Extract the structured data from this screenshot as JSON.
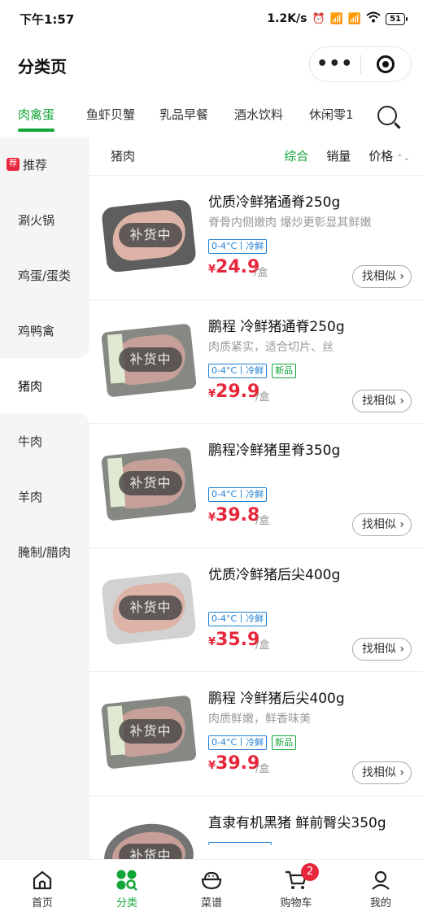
{
  "status_bar": {
    "time": "下午1:57",
    "net_speed": "1.2K/s",
    "battery": "51"
  },
  "title_bar": {
    "title": "分类页",
    "more_label": "•••"
  },
  "tabs": [
    {
      "label": "肉禽蛋",
      "active": true
    },
    {
      "label": "鱼虾贝蟹",
      "active": false
    },
    {
      "label": "乳品早餐",
      "active": false
    },
    {
      "label": "酒水饮料",
      "active": false
    },
    {
      "label": "休闲零1",
      "active": false
    }
  ],
  "sidebar": {
    "recommend_badge": "荐",
    "items": [
      {
        "label": "推荐"
      },
      {
        "label": "涮火锅"
      },
      {
        "label": "鸡蛋/蛋类"
      },
      {
        "label": "鸡鸭禽"
      },
      {
        "label": "猪肉",
        "active": true
      },
      {
        "label": "牛肉"
      },
      {
        "label": "羊肉"
      },
      {
        "label": "腌制/腊肉"
      }
    ]
  },
  "subheader": {
    "category": "猪肉",
    "sort_comprehensive": "综合",
    "sort_sales": "销量",
    "sort_price": "价格"
  },
  "products": [
    {
      "title": "优质冷鲜猪通脊250g",
      "desc": "脊骨内侧嫩肉 爆炒更彰显其鲜嫩",
      "tag_cold": "0-4°C丨冷鲜",
      "tag_new": "",
      "yen": "¥",
      "price": "24.9",
      "unit": "/盒",
      "stock": "补货中",
      "similar": "找相似 ›"
    },
    {
      "title": "鹏程 冷鲜猪通脊250g",
      "desc": "肉质紧实，适合切片、丝",
      "tag_cold": "0-4°C丨冷鲜",
      "tag_new": "新品",
      "yen": "¥",
      "price": "29.9",
      "unit": "/盒",
      "stock": "补货中",
      "similar": "找相似 ›"
    },
    {
      "title": "鹏程冷鲜猪里脊350g",
      "desc": "",
      "tag_cold": "0-4°C丨冷鲜",
      "tag_new": "",
      "yen": "¥",
      "price": "39.8",
      "unit": "/盒",
      "stock": "补货中",
      "similar": "找相似 ›"
    },
    {
      "title": "优质冷鲜猪后尖400g",
      "desc": "",
      "tag_cold": "0-4°C丨冷鲜",
      "tag_new": "",
      "yen": "¥",
      "price": "35.9",
      "unit": "/盒",
      "stock": "补货中",
      "similar": "找相似 ›"
    },
    {
      "title": "鹏程 冷鲜猪后尖400g",
      "desc": "肉质鲜嫩，鲜香味美",
      "tag_cold": "0-4°C丨冷鲜",
      "tag_new": "新品",
      "yen": "¥",
      "price": "39.9",
      "unit": "/盒",
      "stock": "补货中",
      "similar": "找相似 ›"
    },
    {
      "title": "直隶有机黑猪 鲜前臀尖350g",
      "desc": "",
      "tag_cold": "",
      "tag_new": "",
      "yen": "",
      "price": "",
      "unit": "",
      "stock": "补货中",
      "similar": ""
    }
  ],
  "bottom_nav": [
    {
      "label": "首页",
      "icon": "home-icon"
    },
    {
      "label": "分类",
      "icon": "category-icon",
      "active": true
    },
    {
      "label": "菜谱",
      "icon": "recipe-icon"
    },
    {
      "label": "购物车",
      "icon": "cart-icon",
      "badge": "2"
    },
    {
      "label": "我的",
      "icon": "profile-icon"
    }
  ],
  "colors": {
    "accent": "#13a538",
    "price": "#e8273c",
    "cold_tag": "#1d7fd3"
  }
}
